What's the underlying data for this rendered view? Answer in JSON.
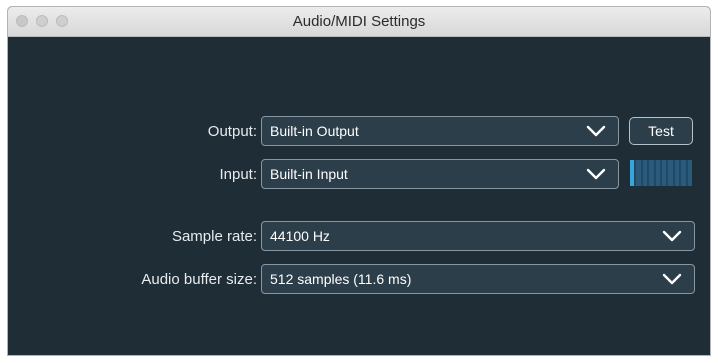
{
  "window": {
    "title": "Audio/MIDI Settings"
  },
  "output": {
    "label": "Output:",
    "value": "Built-in Output",
    "test_label": "Test"
  },
  "input": {
    "label": "Input:",
    "value": "Built-in Input",
    "level_fraction": 0.12
  },
  "sample_rate": {
    "label": "Sample rate:",
    "value": "44100 Hz"
  },
  "buffer_size": {
    "label": "Audio buffer size:",
    "value": "512 samples (11.6 ms)"
  },
  "icons": {
    "dropdown": "chevron-down-icon"
  },
  "colors": {
    "panel_bg": "#1f2d37",
    "field_bg": "#2c3e4a",
    "meter_active": "#3aa5d8"
  }
}
